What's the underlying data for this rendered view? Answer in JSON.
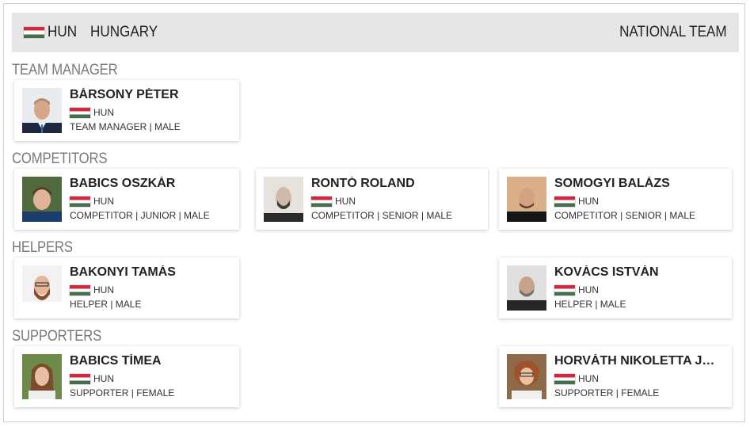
{
  "header": {
    "country_code": "HUN",
    "country_name": "HUNGARY",
    "team_label": "NATIONAL TEAM",
    "flag_icon": "hungary-flag-icon",
    "flag_colors": [
      "#cd2a3e",
      "#ffffff",
      "#436f4d"
    ]
  },
  "sections": [
    {
      "title": "TEAM MANAGER",
      "members": [
        {
          "name": "BÁRSONY PÉTER",
          "code": "HUN",
          "role": "TEAM MANAGER | MALE"
        }
      ]
    },
    {
      "title": "COMPETITORS",
      "members": [
        {
          "name": "BABICS OSZKÁR",
          "code": "HUN",
          "role": "COMPETITOR | JUNIOR | MALE"
        },
        {
          "name": "RONTÓ ROLAND",
          "code": "HUN",
          "role": "COMPETITOR | SENIOR | MALE"
        },
        {
          "name": "SOMOGYI BALÁZS",
          "code": "HUN",
          "role": "COMPETITOR | SENIOR | MALE"
        }
      ]
    },
    {
      "title": "HELPERS",
      "members": [
        {
          "name": "BAKONYI TAMÁS",
          "code": "HUN",
          "role": "HELPER | MALE"
        },
        {
          "name": "KOVÁCS ISTVÁN",
          "code": "HUN",
          "role": "HELPER | MALE"
        }
      ]
    },
    {
      "title": "SUPPORTERS",
      "members": [
        {
          "name": "BABICS TÍMEA",
          "code": "HUN",
          "role": "SUPPORTER | FEMALE"
        },
        {
          "name": "HORVÁTH NIKOLETTA JU...",
          "code": "HUN",
          "role": "SUPPORTER | FEMALE"
        }
      ]
    }
  ]
}
